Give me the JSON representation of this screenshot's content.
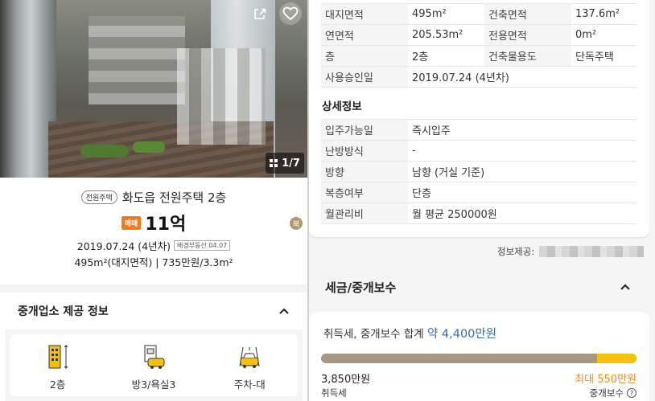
{
  "listing": {
    "photo_counter": "1/7",
    "type_badge": "전원주택",
    "title": "화도읍 전원주택 2층",
    "deal_badge": "매매",
    "price": "11억",
    "approval_date": "2019.07.24 (4년차)",
    "source_badge": "배경부동산 04.07",
    "area_summary": "495m²(대지면적)  |  735만원/3.3m²",
    "compass_label": "북"
  },
  "broker_section": {
    "title": "중개업소 제공 정보",
    "features": [
      {
        "icon": "building-floors-icon",
        "label": "2층"
      },
      {
        "icon": "room-bath-icon",
        "label": "방3/욕실3"
      },
      {
        "icon": "parking-car-icon",
        "label": "주차-대"
      }
    ]
  },
  "basic_info": {
    "rows": [
      {
        "k1": "대지면적",
        "v1": "495m²",
        "k2": "건축면적",
        "v2": "137.6m²"
      },
      {
        "k1": "연면적",
        "v1": "205.53m²",
        "k2": "전용면적",
        "v2": "0m²"
      },
      {
        "k1": "층",
        "v1": "2층",
        "k2": "건축물용도",
        "v2": "단독주택"
      },
      {
        "k1": "사용승인일",
        "v1": "2019.07.24 (4년차)",
        "k2": "",
        "v2": ""
      }
    ]
  },
  "detail_info": {
    "title": "상세정보",
    "rows": [
      {
        "k": "입주가능일",
        "v": "즉시입주"
      },
      {
        "k": "난방방식",
        "v": "-"
      },
      {
        "k": "방향",
        "v": "남향 (거실 기준)"
      },
      {
        "k": "복층여부",
        "v": "단층"
      },
      {
        "k": "월관리비",
        "v": "월 평균 250000원"
      }
    ]
  },
  "provider_label": "정보제공:",
  "tax": {
    "title": "세금/중개보수",
    "sum_label": "취득세, 중개보수 합계",
    "sum_value": "약 4,400만원",
    "acquisition_amount": "3,850만원",
    "acquisition_label": "취득세",
    "brokerage_amount": "최대 550만원",
    "brokerage_label": "중개보수",
    "acquisition_share": 0.875,
    "brokerage_share": 0.125,
    "colors": {
      "acquisition": "#a89882",
      "brokerage": "#f5c10e"
    }
  }
}
